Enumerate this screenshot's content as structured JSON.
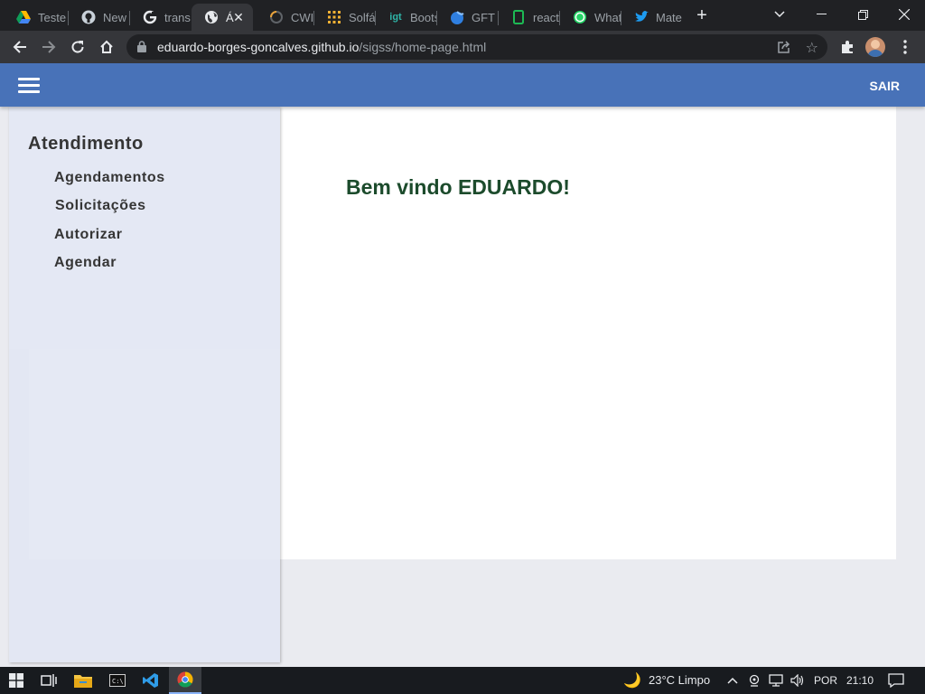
{
  "browser": {
    "tabs": [
      {
        "title": "Teste",
        "icon": "google-drive-icon"
      },
      {
        "title": "New",
        "icon": "github-icon"
      },
      {
        "title": "trans",
        "icon": "google-icon"
      },
      {
        "title": "Á",
        "icon": "globe-icon"
      },
      {
        "title": "CWI (",
        "icon": "loading-icon"
      },
      {
        "title": "Solfá",
        "icon": "grid-icon"
      },
      {
        "title": "Boots",
        "icon": "getbootstrap-icon"
      },
      {
        "title": "GFT S",
        "icon": "gft-icon"
      },
      {
        "title": "react",
        "icon": "device-icon"
      },
      {
        "title": "What",
        "icon": "whatsapp-icon"
      },
      {
        "title": "Mate",
        "icon": "twitter-icon"
      }
    ],
    "new_tab": "+",
    "address": {
      "host": "eduardo-borges-goncalves.github.io",
      "path": "/sigss/home-page.html"
    }
  },
  "app": {
    "header": {
      "logout_label": "SAIR"
    },
    "sidebar": {
      "heading": "Atendimento",
      "items": [
        {
          "label": "Agendamentos"
        },
        {
          "label": "Solicitações"
        },
        {
          "label": "Autorizar"
        },
        {
          "label": "Agendar"
        }
      ]
    },
    "main": {
      "welcome": "Bem vindo EDUARDO!"
    }
  },
  "taskbar": {
    "weather": "23°C  Limpo",
    "language": "POR",
    "time": "21:10"
  },
  "colors": {
    "app_header": "#4872b8",
    "welcome_text": "#1c4b2c",
    "sidebar_bg": "#e4e8f4"
  }
}
